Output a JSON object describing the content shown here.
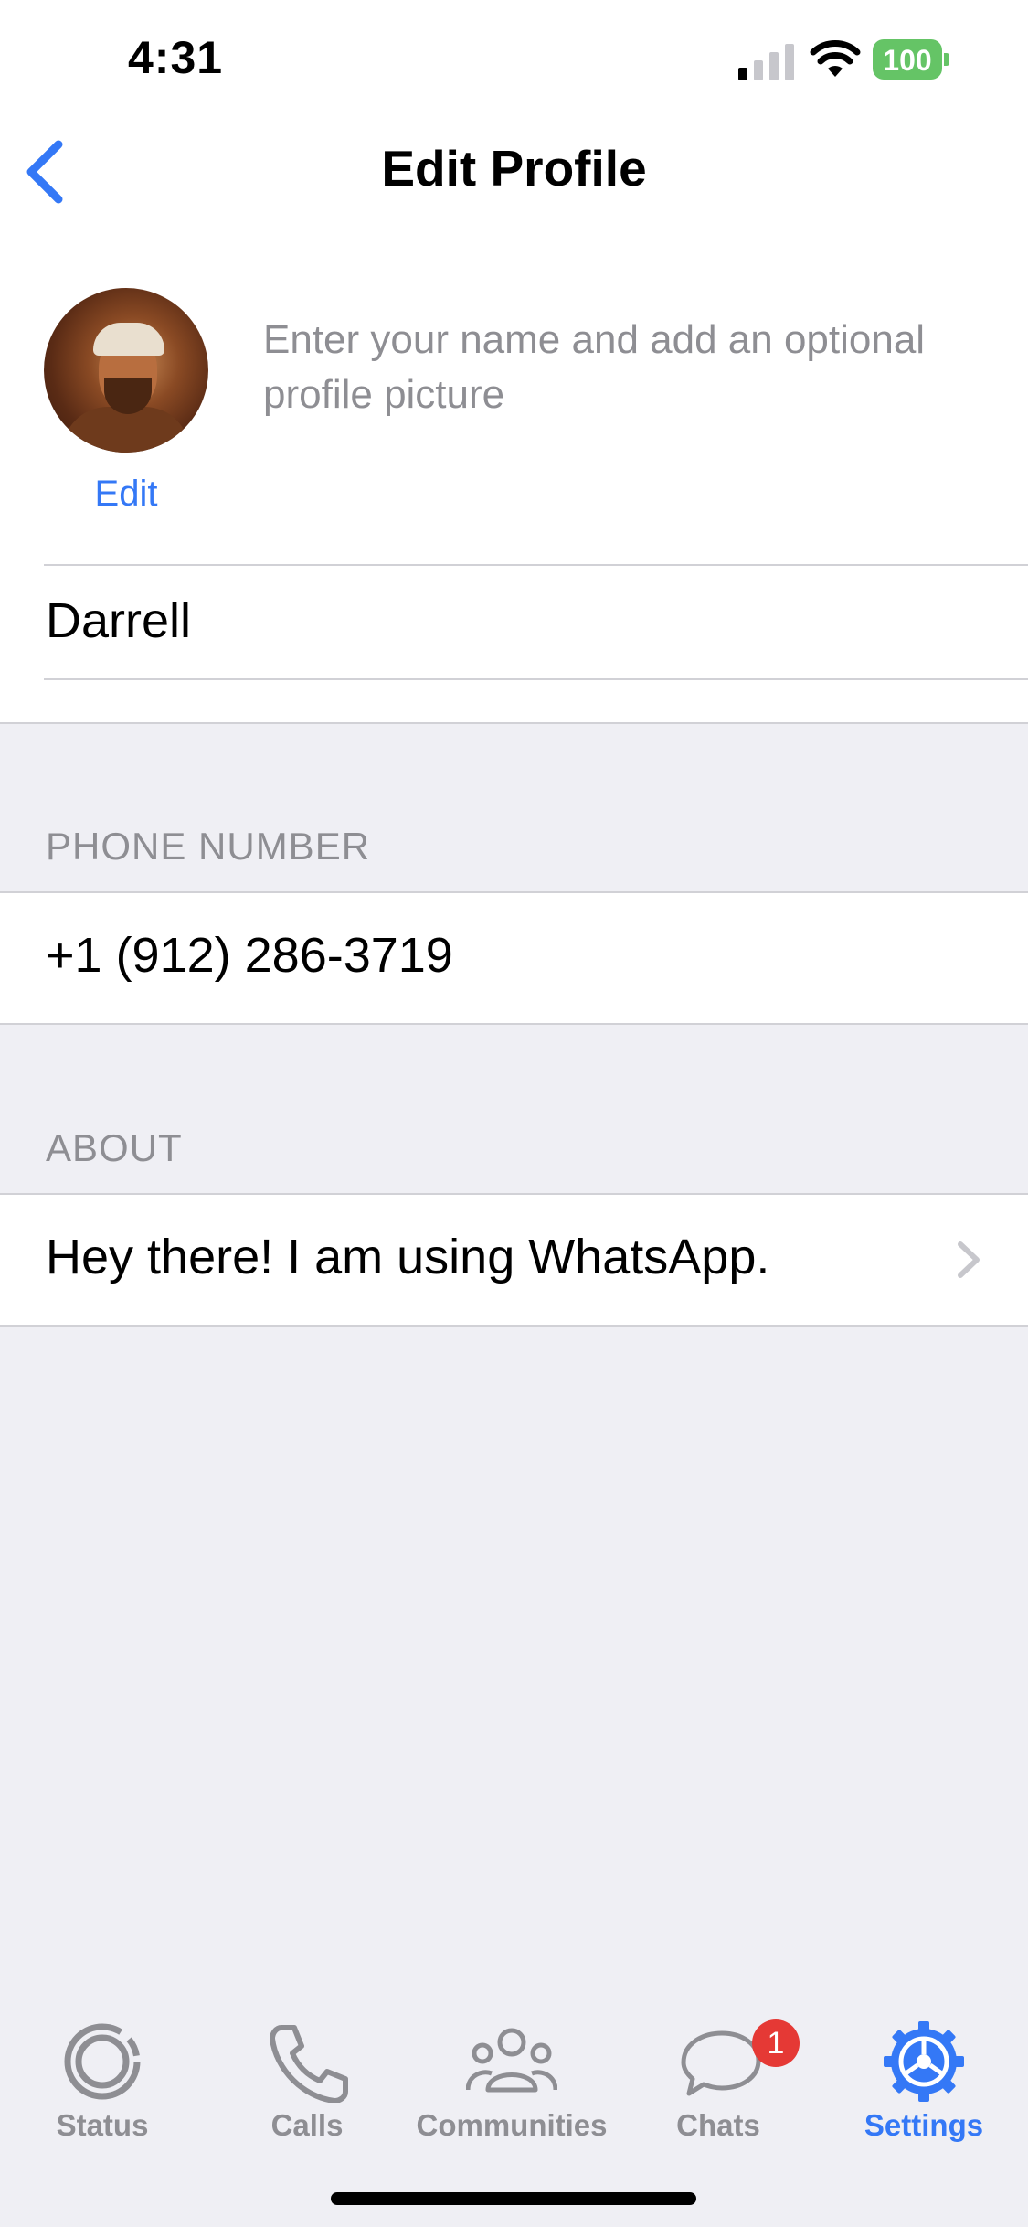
{
  "status_bar": {
    "time": "4:31",
    "battery": "100"
  },
  "nav": {
    "title": "Edit Profile"
  },
  "profile": {
    "edit_label": "Edit",
    "hint": "Enter your name and add an optional profile picture",
    "name_value": "Darrell"
  },
  "phone": {
    "header": "PHONE NUMBER",
    "value": "+1 (912) 286-3719"
  },
  "about": {
    "header": "ABOUT",
    "value": "Hey there! I am using WhatsApp."
  },
  "tabs": [
    {
      "label": "Status",
      "icon": "status-icon"
    },
    {
      "label": "Calls",
      "icon": "phone-icon"
    },
    {
      "label": "Communities",
      "icon": "communities-icon"
    },
    {
      "label": "Chats",
      "icon": "chats-icon",
      "badge": "1"
    },
    {
      "label": "Settings",
      "icon": "settings-icon",
      "active": true
    }
  ],
  "colors": {
    "accent": "#3478f6",
    "battery": "#65c466",
    "badge": "#e53935"
  }
}
